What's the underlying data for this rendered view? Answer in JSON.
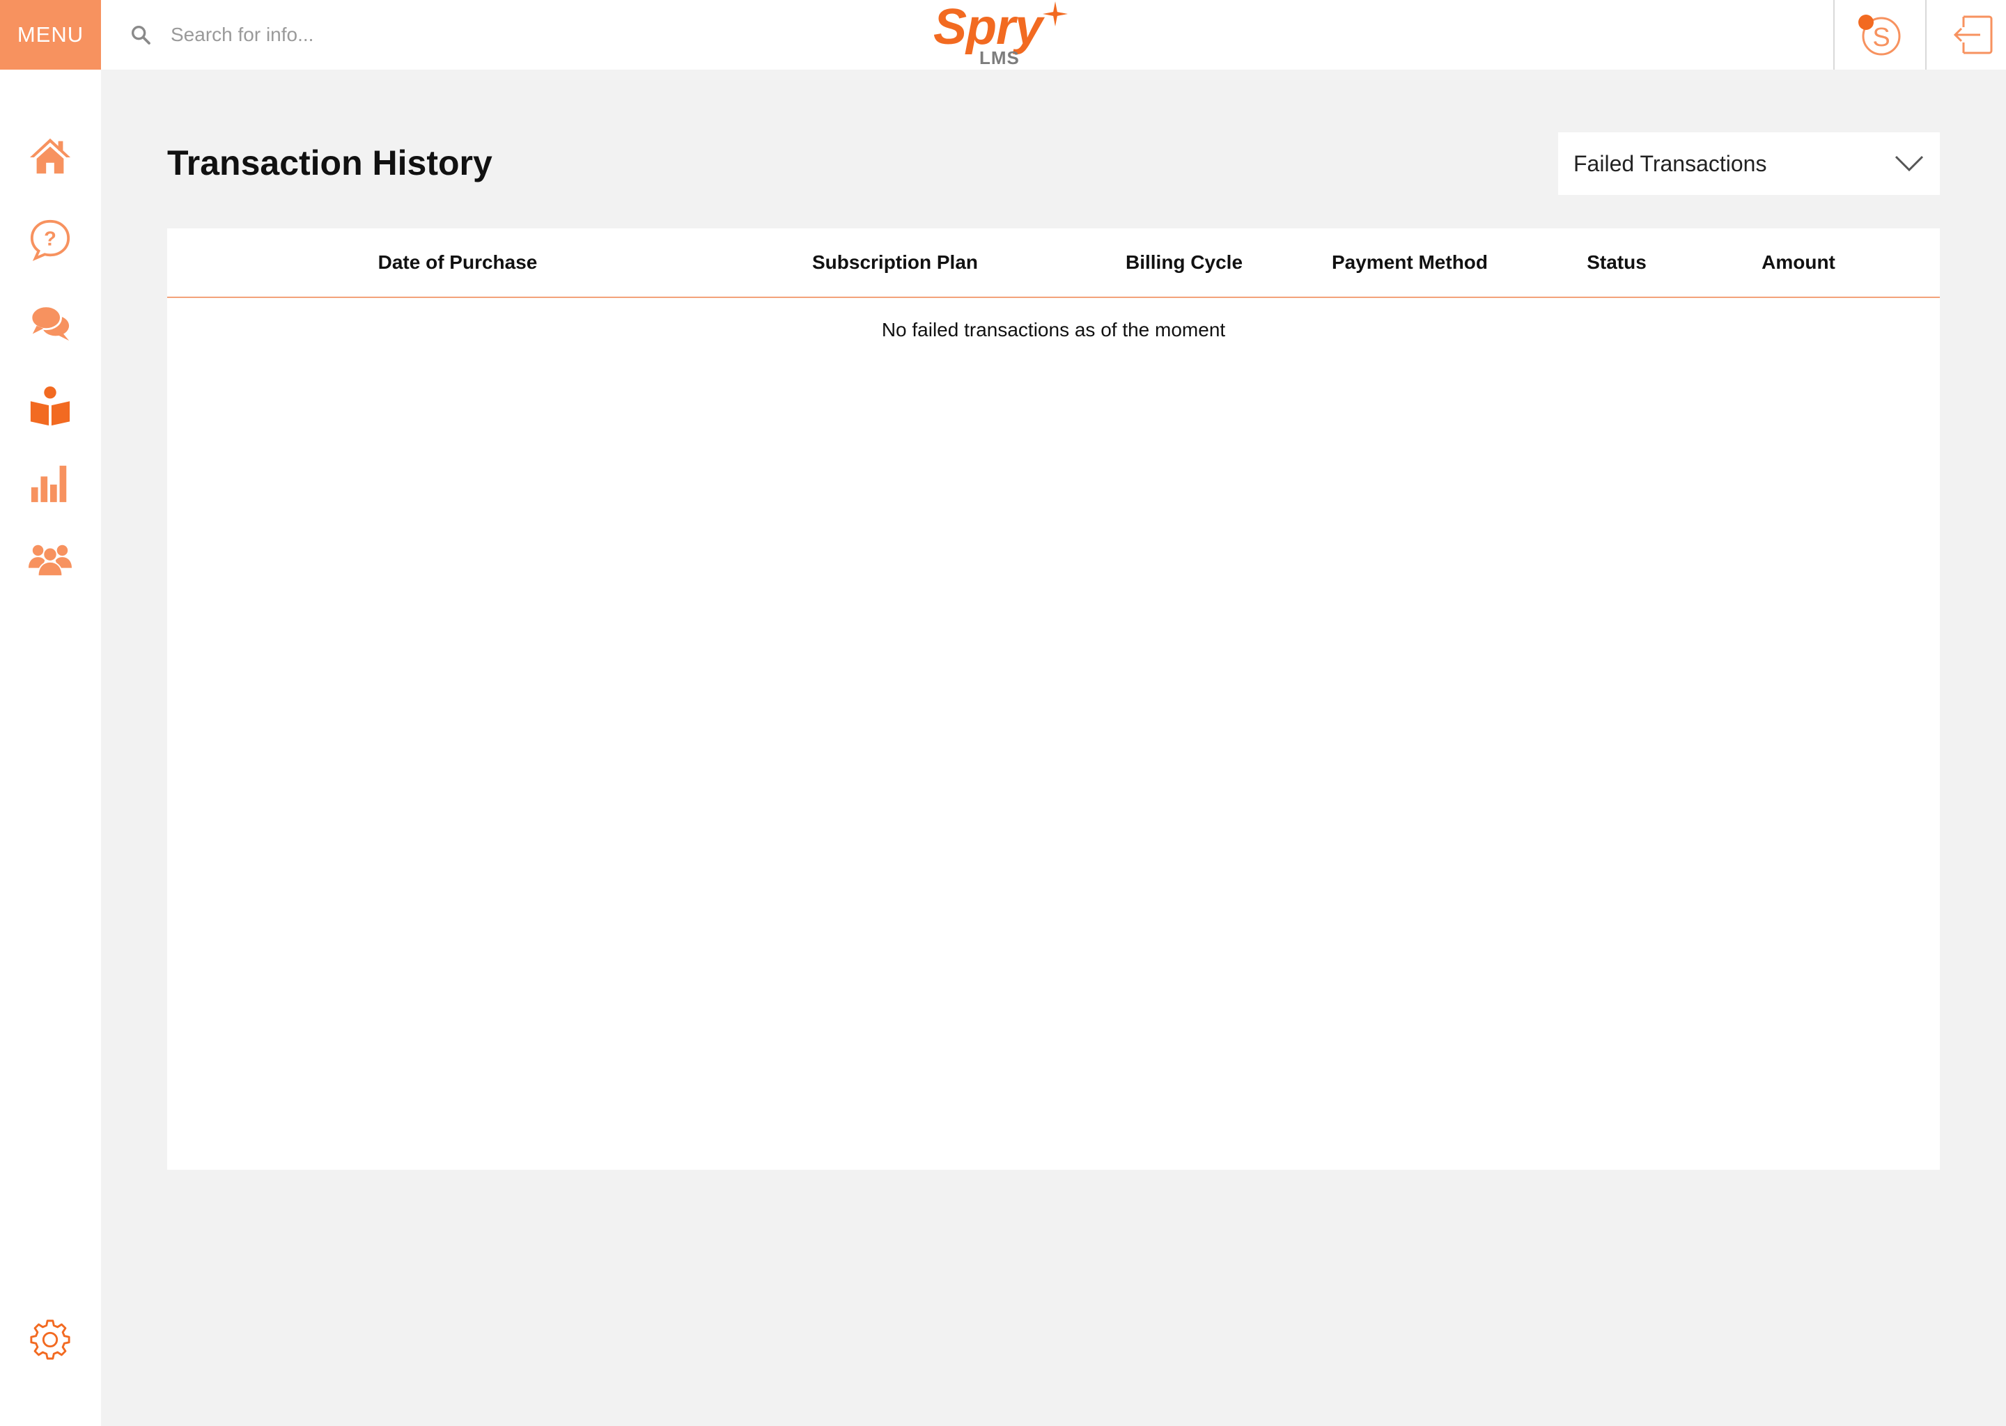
{
  "header": {
    "menu_label": "MENU",
    "search_placeholder": "Search for info...",
    "logo": {
      "main": "Spry",
      "sub": "LMS"
    },
    "icons": [
      "search-icon",
      "coin-icon",
      "logout-icon"
    ]
  },
  "sidebar": {
    "items": [
      {
        "name": "home",
        "icon": "home-icon",
        "active": false
      },
      {
        "name": "help",
        "icon": "question-bubble-icon",
        "active": false
      },
      {
        "name": "chat",
        "icon": "chat-icon",
        "active": false
      },
      {
        "name": "learning",
        "icon": "reading-book-icon",
        "active": true
      },
      {
        "name": "reports",
        "icon": "bar-chart-icon",
        "active": false
      },
      {
        "name": "community",
        "icon": "users-icon",
        "active": false
      }
    ],
    "settings_icon": "gear-icon"
  },
  "page": {
    "title": "Transaction History",
    "filter": {
      "selected": "Failed Transactions"
    }
  },
  "table": {
    "columns": [
      "Date of Purchase",
      "Subscription Plan",
      "Billing Cycle",
      "Payment Method",
      "Status",
      "Amount"
    ],
    "rows": [],
    "empty_message": "No failed transactions as of the moment"
  },
  "colors": {
    "accent": "#f26a21",
    "accent_light": "#f7925f",
    "background": "#f2f2f2",
    "panel": "#ffffff"
  }
}
